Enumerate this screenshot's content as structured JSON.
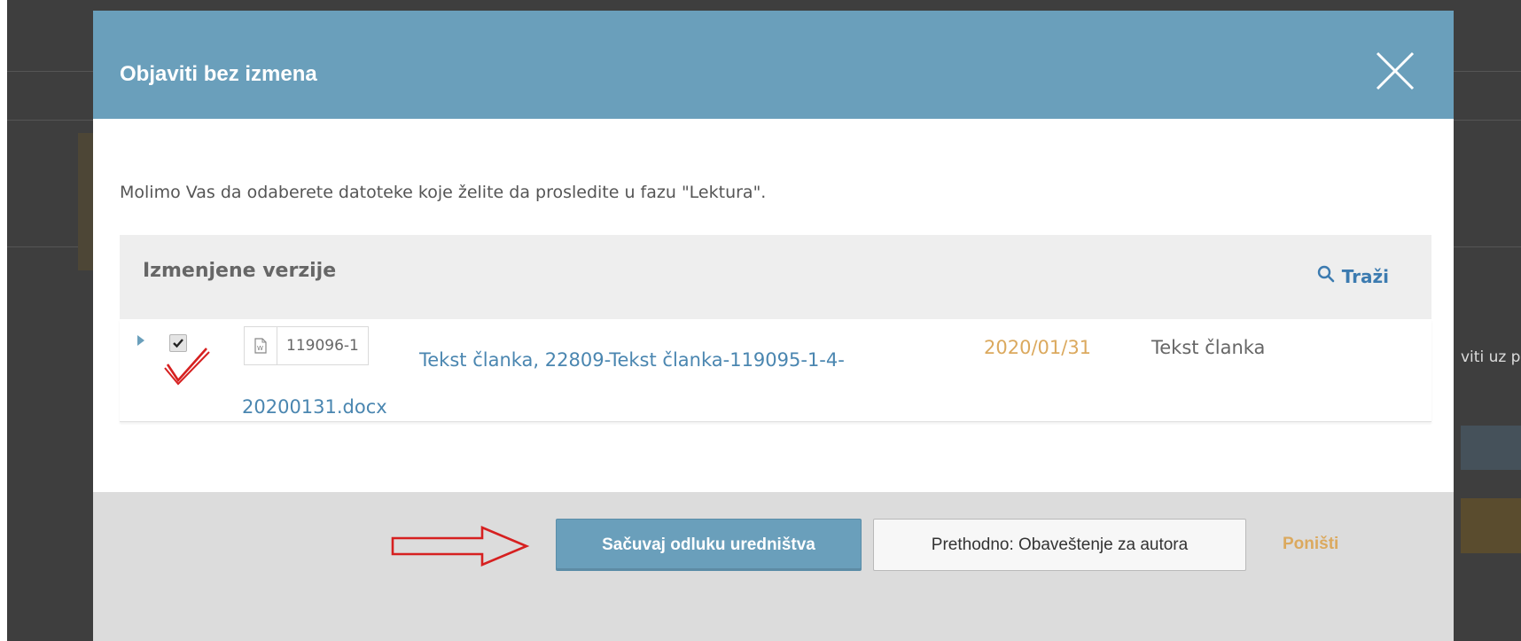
{
  "colors": {
    "header_bg": "#6a9fbb",
    "link": "#4a86b0",
    "date": "#dba95e",
    "footer_bg": "#dcdcdc",
    "annotation_red": "#d62020"
  },
  "background": {
    "right_text": "viti uz p"
  },
  "modal": {
    "title": "Objaviti bez izmena",
    "close_icon": "close-icon",
    "intro": "Molimo Vas da odaberete datoteke koje želite da prosledite u fazu \"Lektura\"."
  },
  "grid": {
    "title": "Izmenjene verzije",
    "search_label": "Traži",
    "rows": [
      {
        "checked": true,
        "file_icon": "word-file-icon",
        "file_id": "119096-1",
        "file_name": "Tekst članka, 22809-Tekst članka-119095-1-4-20200131.docx",
        "date": "2020/01/31",
        "type": "Tekst članka"
      }
    ]
  },
  "footer": {
    "primary_button": "Sačuvaj odluku uredništva",
    "secondary_button": "Prethodno: Obaveštenje za autora",
    "cancel_link": "Poništi"
  }
}
